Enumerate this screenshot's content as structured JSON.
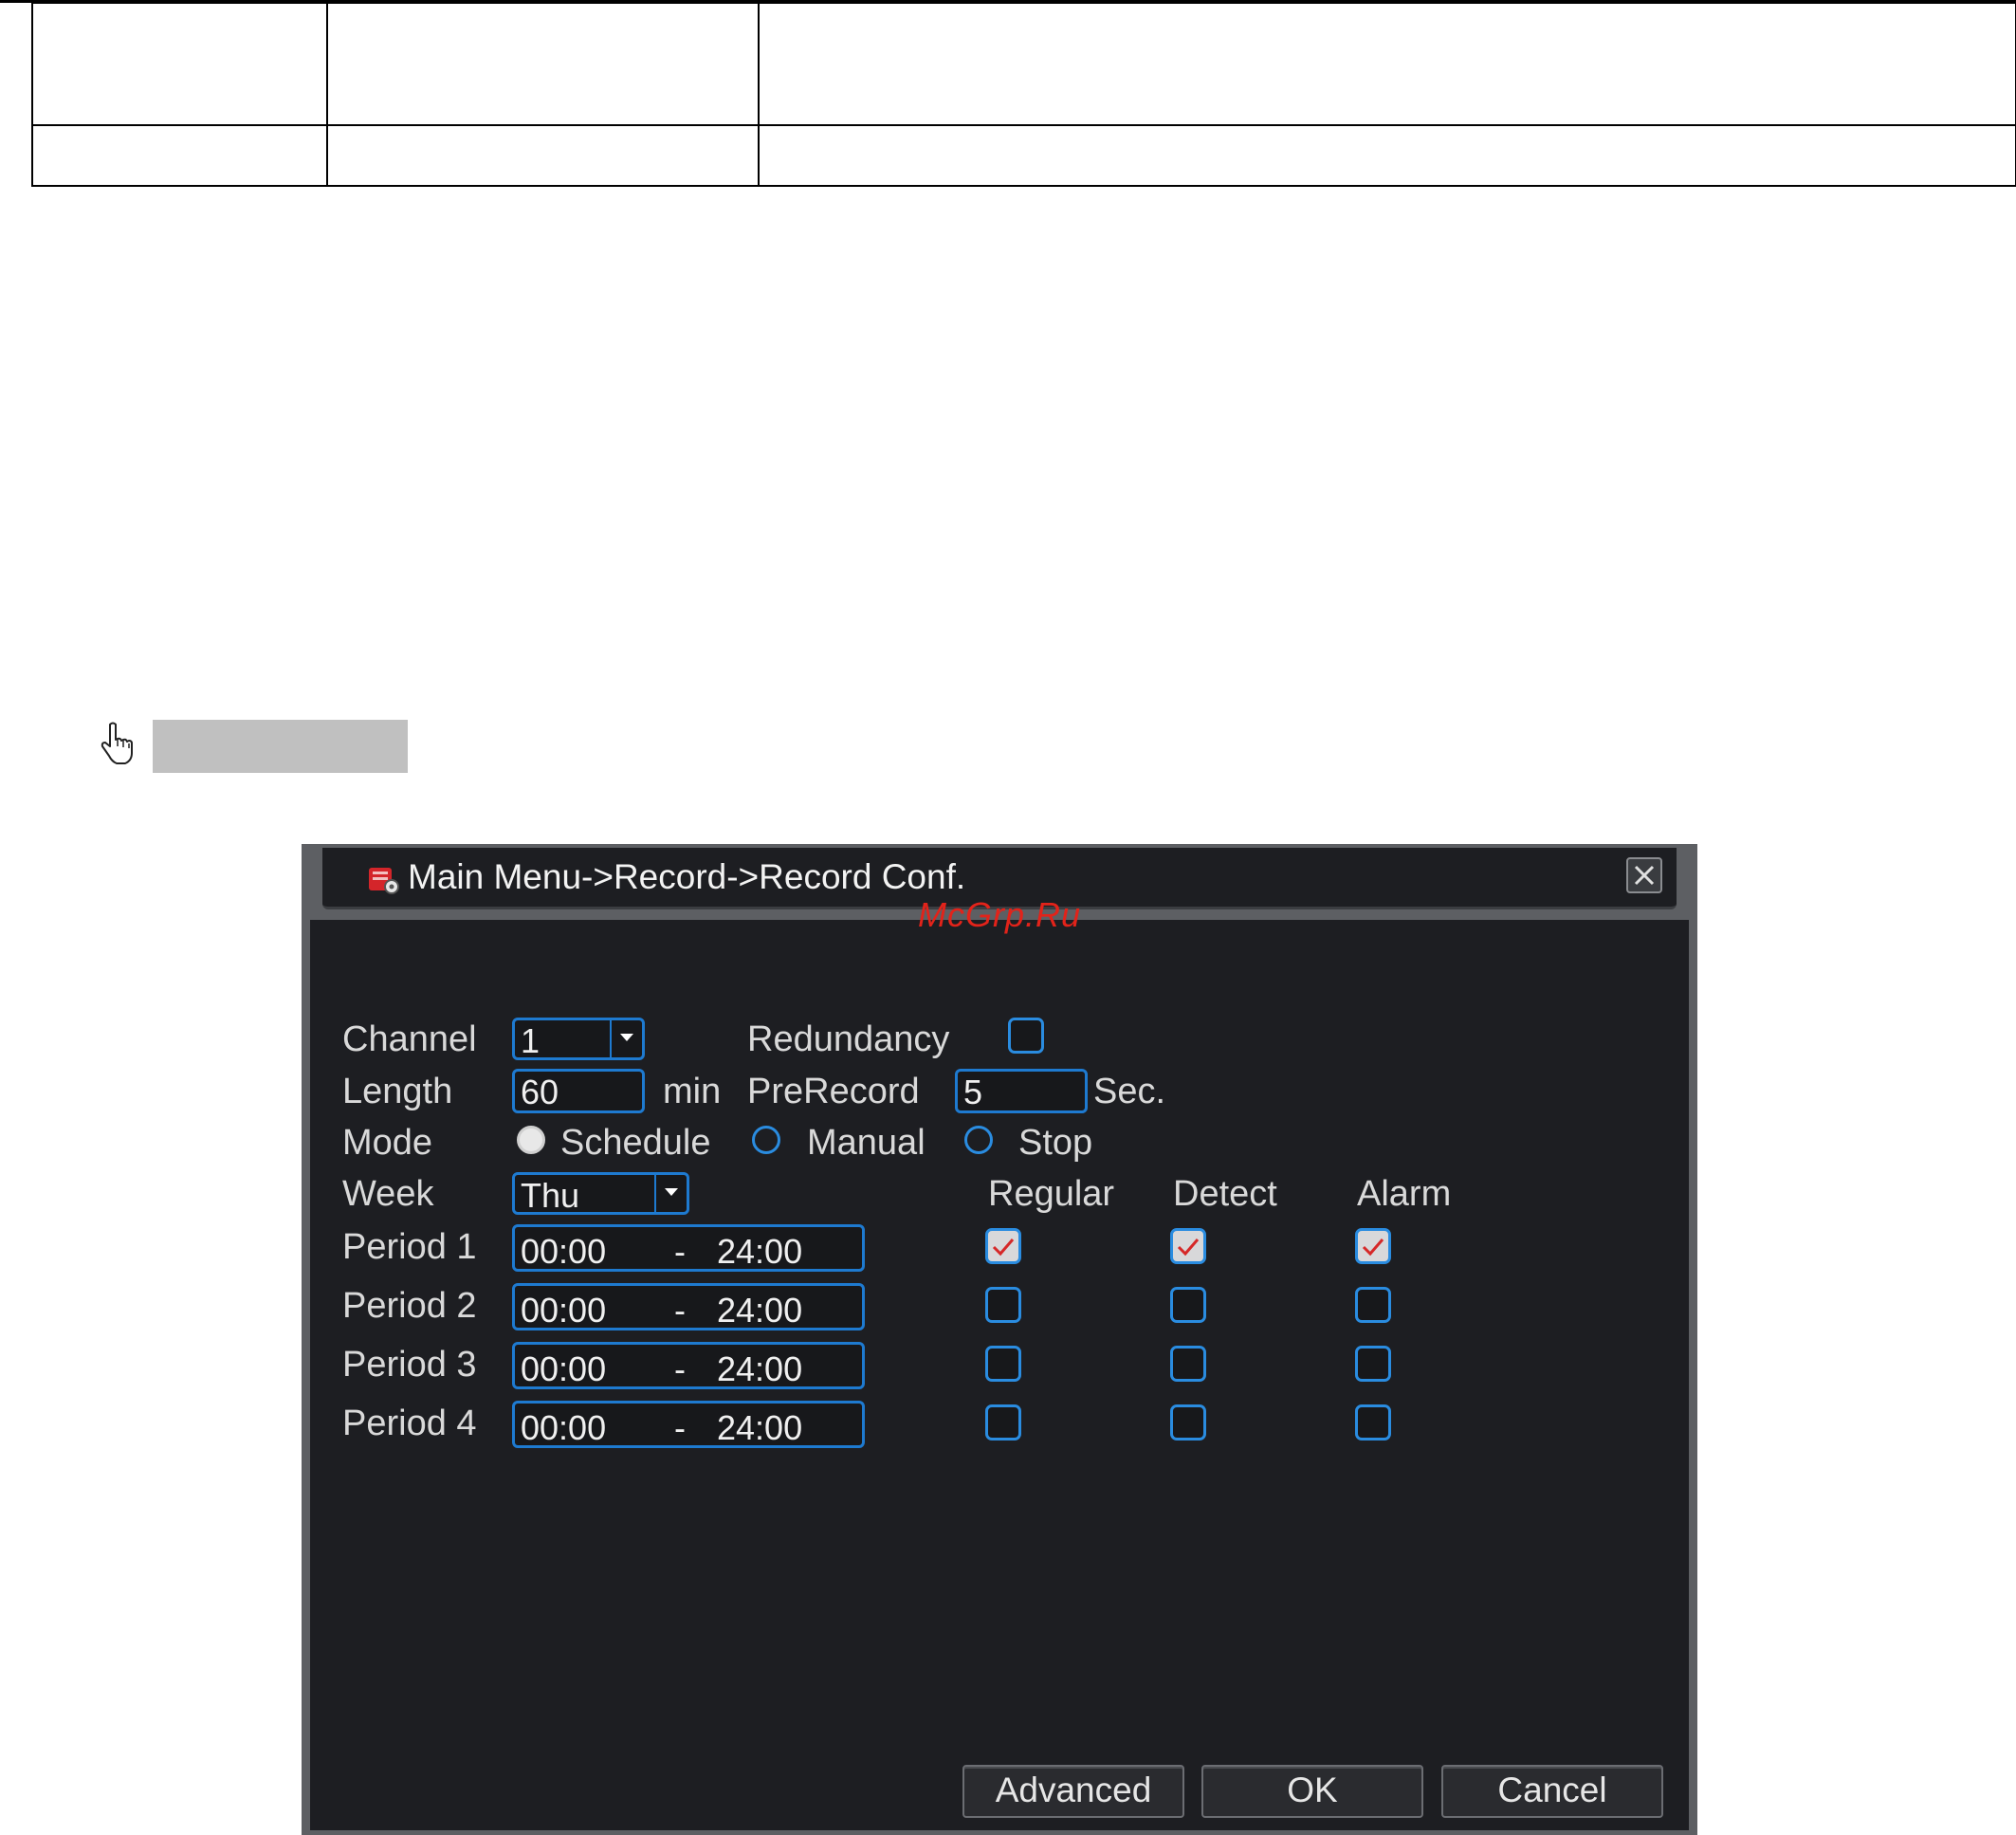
{
  "document": {
    "table": {
      "rows": [
        [
          "",
          "",
          ""
        ],
        [
          "",
          "",
          ""
        ]
      ]
    }
  },
  "dialog": {
    "title": "Main Menu->Record->Record Conf.",
    "watermark": "McGrp.Ru",
    "labels": {
      "channel": "Channel",
      "redundancy": "Redundancy",
      "length": "Length",
      "length_unit": "min",
      "prerecord": "PreRecord",
      "prerecord_unit": "Sec.",
      "mode": "Mode",
      "week": "Week"
    },
    "values": {
      "channel": "1",
      "length": "60",
      "prerecord": "5",
      "week": "Thu",
      "redundancy_checked": false
    },
    "mode_options": [
      {
        "label": "Schedule",
        "selected": true
      },
      {
        "label": "Manual",
        "selected": false
      },
      {
        "label": "Stop",
        "selected": false
      }
    ],
    "columns": [
      "Regular",
      "Detect",
      "Alarm"
    ],
    "periods": [
      {
        "label": "Period 1",
        "start": "00:00",
        "sep": "-",
        "end": "24:00",
        "checks": [
          true,
          true,
          true
        ]
      },
      {
        "label": "Period 2",
        "start": "00:00",
        "sep": "-",
        "end": "24:00",
        "checks": [
          false,
          false,
          false
        ]
      },
      {
        "label": "Period 3",
        "start": "00:00",
        "sep": "-",
        "end": "24:00",
        "checks": [
          false,
          false,
          false
        ]
      },
      {
        "label": "Period 4",
        "start": "00:00",
        "sep": "-",
        "end": "24:00",
        "checks": [
          false,
          false,
          false
        ]
      }
    ],
    "buttons": {
      "advanced": "Advanced",
      "ok": "OK",
      "cancel": "Cancel"
    }
  },
  "colors": {
    "accent": "#1e7ad0",
    "window_frame": "#5d5f63",
    "panel": "#1d1e22",
    "check_mark": "#d62828",
    "watermark": "#e2231a"
  }
}
